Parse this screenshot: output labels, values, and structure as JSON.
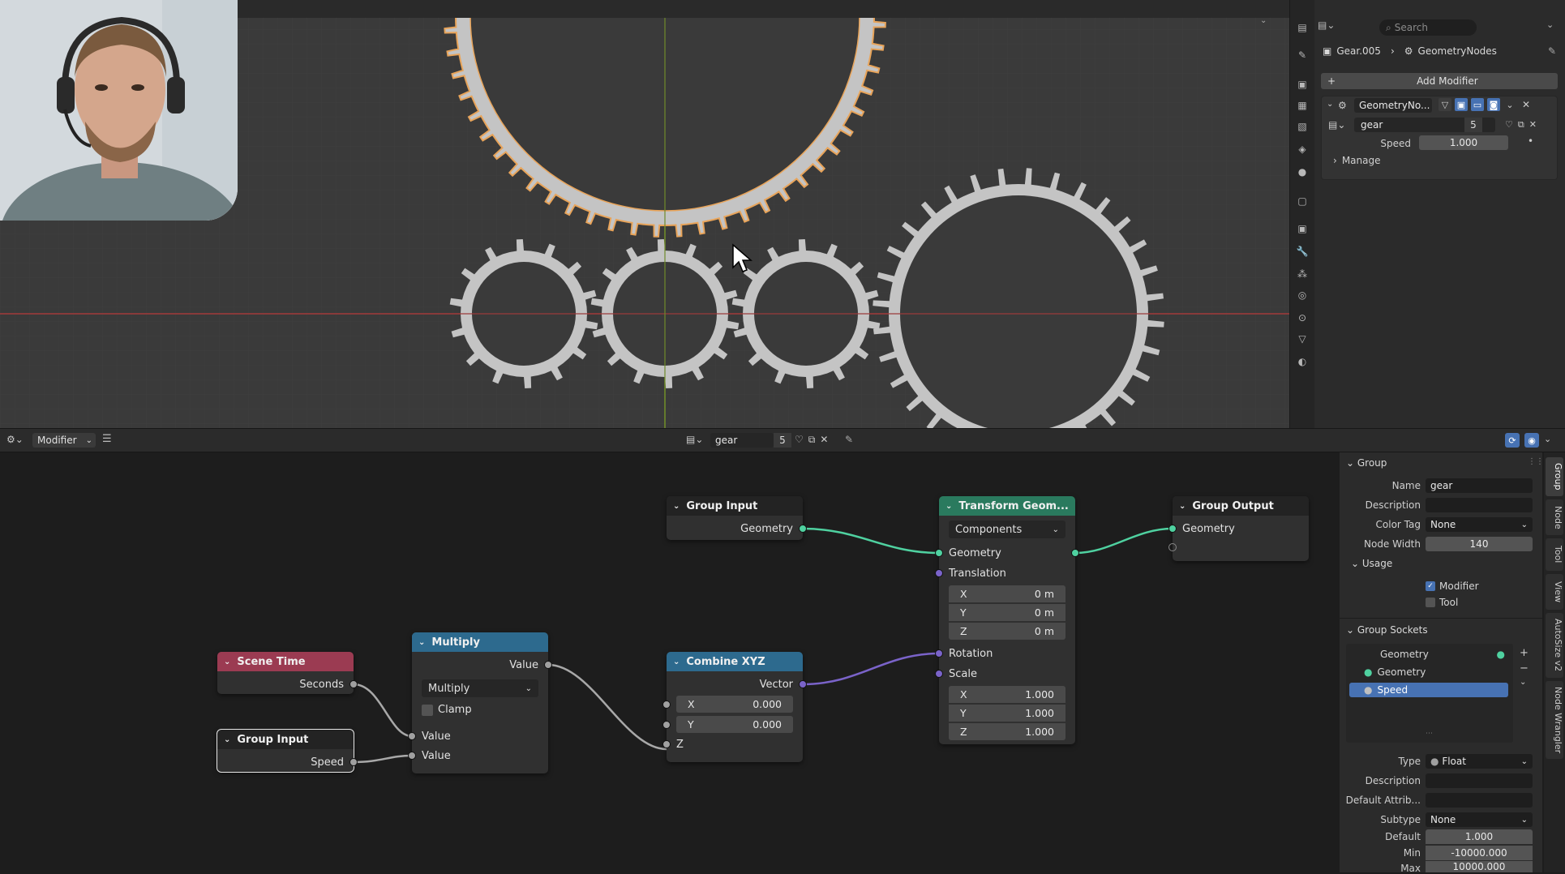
{
  "viewport": {
    "accent_orange": "#e8a45a",
    "gear_color": "#c4c4c4",
    "x_axis_color": "#9a3b3b",
    "y_axis_color": "#6f8a2a"
  },
  "properties": {
    "search_placeholder": "Search",
    "breadcrumb_object": "Gear.005",
    "breadcrumb_modifier": "GeometryNodes",
    "add_modifier_label": "Add Modifier",
    "modifier_name": "GeometryNo...",
    "node_group_name": "gear",
    "node_group_users": "5",
    "speed_label": "Speed",
    "speed_value": "1.000",
    "manage_label": "Manage"
  },
  "node_editor_header": {
    "editor_type": "Modifier",
    "node_group_name": "gear",
    "users": "5"
  },
  "nodes": {
    "group_input_top": {
      "title": "Group Input",
      "geometry": "Geometry"
    },
    "transform": {
      "title": "Transform Geom...",
      "mode": "Components",
      "geometry": "Geometry",
      "translation": "Translation",
      "tx_label": "X",
      "tx": "0 m",
      "ty_label": "Y",
      "ty": "0 m",
      "tz_label": "Z",
      "tz": "0 m",
      "rotation": "Rotation",
      "scale": "Scale",
      "sx_label": "X",
      "sx": "1.000",
      "sy_label": "Y",
      "sy": "1.000",
      "sz_label": "Z",
      "sz": "1.000"
    },
    "group_output": {
      "title": "Group Output",
      "geometry": "Geometry"
    },
    "scene_time": {
      "title": "Scene Time",
      "seconds": "Seconds"
    },
    "group_input_bottom": {
      "title": "Group Input",
      "speed": "Speed"
    },
    "multiply": {
      "title": "Multiply",
      "out_value": "Value",
      "operation": "Multiply",
      "clamp": "Clamp",
      "in_value1": "Value",
      "in_value2": "Value"
    },
    "combine_xyz": {
      "title": "Combine XYZ",
      "vector": "Vector",
      "x_label": "X",
      "x": "0.000",
      "y_label": "Y",
      "y": "0.000",
      "z_label": "Z"
    }
  },
  "side_panel": {
    "group_title": "Group",
    "name_label": "Name",
    "name_value": "gear",
    "description_label": "Description",
    "color_tag_label": "Color Tag",
    "color_tag_value": "None",
    "node_width_label": "Node Width",
    "node_width_value": "140",
    "usage_title": "Usage",
    "modifier_label": "Modifier",
    "tool_label": "Tool",
    "sockets_title": "Group Sockets",
    "sockets": [
      "Geometry",
      "Geometry",
      "Speed"
    ],
    "type_label": "Type",
    "type_value": "Float",
    "desc2_label": "Description",
    "default_attrib_label": "Default Attrib...",
    "subtype_label": "Subtype",
    "subtype_value": "None",
    "default_label": "Default",
    "default_value": "1.000",
    "min_label": "Min",
    "min_value": "-10000.000",
    "max_label": "Max",
    "max_value": "10000.000",
    "tabs": [
      "Group",
      "Node",
      "Tool",
      "View",
      "AutoSize v2",
      "Node Wrangler"
    ]
  }
}
